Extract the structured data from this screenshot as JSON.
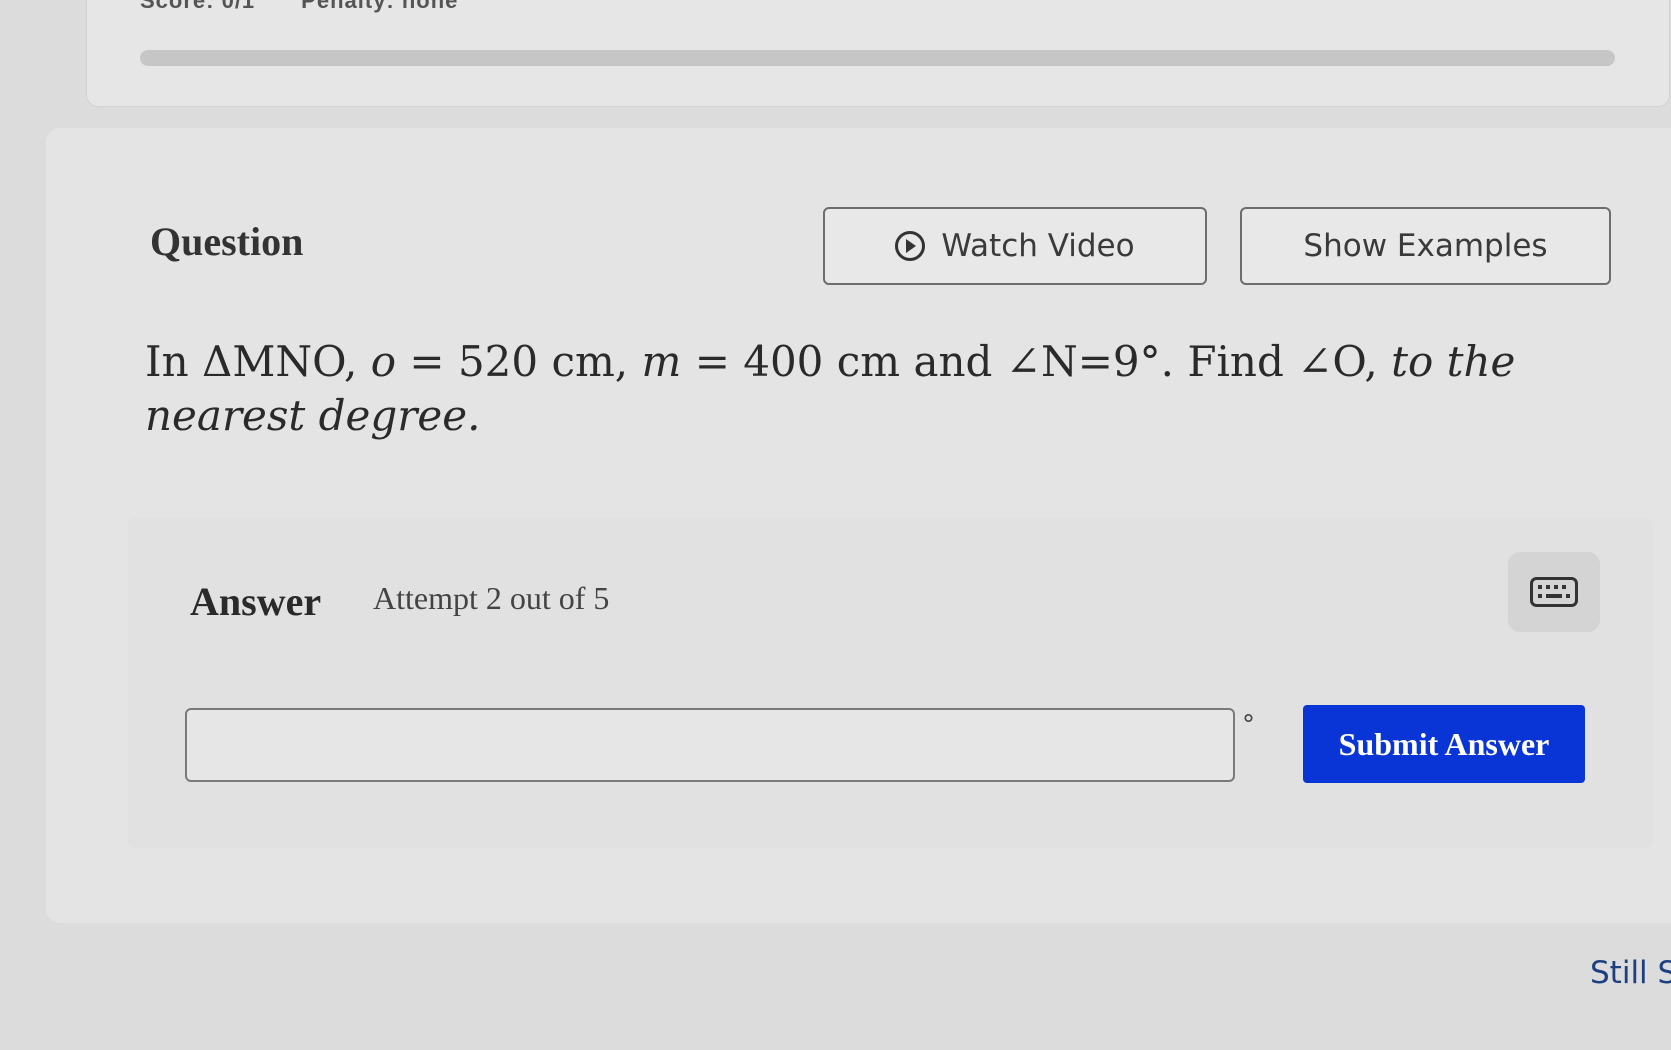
{
  "header": {
    "score": "Score: 0/1",
    "penalty": "Penalty: none"
  },
  "question": {
    "title": "Question",
    "watch_video_label": "Watch Video",
    "show_examples_label": "Show Examples",
    "text": {
      "p1": "In ΔMNO, ",
      "v1": "o",
      "p2": " = 520 cm, ",
      "v2": "m",
      "p3": " = 400 cm and ∠N=9°. Find ∠O, ",
      "tail": "to the nearest degree."
    }
  },
  "answer": {
    "label": "Answer",
    "attempt": "Attempt 2 out of 5",
    "input_value": "",
    "unit": "°",
    "submit_label": "Submit Answer"
  },
  "footer": {
    "help_link": "Still St"
  },
  "icons": {
    "watch": "play-circle-icon",
    "keyboard": "keyboard-icon"
  },
  "colors": {
    "submit": "#0a35d6",
    "link": "#1c3f80"
  }
}
